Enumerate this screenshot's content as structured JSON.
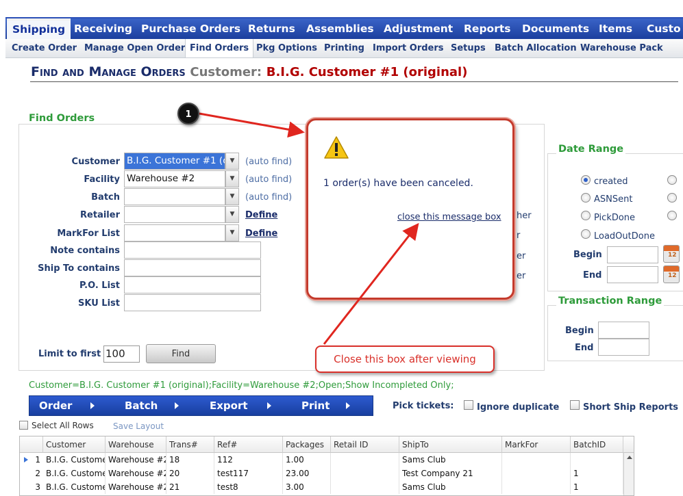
{
  "nav": {
    "top": [
      "Shipping",
      "Receiving",
      "Purchase Orders",
      "Returns",
      "Assemblies",
      "Adjustment",
      "Reports",
      "Documents",
      "Items",
      "Custo"
    ],
    "sub": [
      "Create Order",
      "Manage Open Order",
      "Find Orders",
      "Pkg Options",
      "Printing",
      "Import Orders",
      "Setups",
      "Batch Allocation",
      "Warehouse Pack"
    ]
  },
  "page": {
    "title": "Find and Manage Orders",
    "customer_label": "Customer:",
    "customer_value": "B.I.G. Customer #1 (original)"
  },
  "find_orders": {
    "legend": "Find Orders",
    "fields": {
      "customer": {
        "label": "Customer",
        "value": "B.I.G. Customer #1 (or",
        "hint": "(auto find)"
      },
      "facility": {
        "label": "Facility",
        "value": "Warehouse #2",
        "hint": "(auto find)"
      },
      "batch": {
        "label": "Batch",
        "value": "",
        "hint": "(auto find)"
      },
      "retailer": {
        "label": "Retailer",
        "value": "",
        "link": "Define"
      },
      "markfor": {
        "label": "MarkFor List",
        "value": "",
        "link": "Define"
      },
      "note": {
        "label": "Note contains",
        "value": ""
      },
      "shipto": {
        "label": "Ship To contains",
        "value": ""
      },
      "po": {
        "label": "P.O. List",
        "value": ""
      },
      "sku": {
        "label": "SKU List",
        "value": ""
      }
    },
    "partial_labels": [
      "her",
      "r",
      "er",
      "er"
    ],
    "limit_label": "Limit to first",
    "limit_value": "100",
    "find_button": "Find"
  },
  "date_range": {
    "legend": "Date Range",
    "options": [
      {
        "label": "created",
        "selected": true
      },
      {
        "label": "ASNSent",
        "selected": false
      },
      {
        "label": "PickDone",
        "selected": false
      },
      {
        "label": "LoadOutDone",
        "selected": false
      }
    ],
    "begin_label": "Begin",
    "end_label": "End"
  },
  "transaction_range": {
    "legend": "Transaction Range",
    "begin_label": "Begin",
    "end_label": "End"
  },
  "message_box": {
    "text": "1 order(s) have been canceled.",
    "close_link": "close this message box"
  },
  "annotation": {
    "step": "1",
    "callout": "Close this box after viewing",
    "color": "#d9302a"
  },
  "filter_summary": "Customer=B.I.G. Customer #1 (original);Facility=Warehouse #2;Open;Show Incompleted Only;",
  "actions": [
    "Order",
    "Batch",
    "Export",
    "Print"
  ],
  "pick_tickets": {
    "label": "Pick tickets:",
    "ignore_duplicate": "Ignore duplicate",
    "short_ship_reports": "Short Ship Reports"
  },
  "grid": {
    "select_all": "Select All Rows",
    "save_layout": "Save Layout",
    "columns": [
      "Customer",
      "Warehouse",
      "Trans#",
      "Ref#",
      "Packages",
      "Retail ID",
      "ShipTo",
      "MarkFor",
      "BatchID"
    ],
    "rows": [
      {
        "num": "1",
        "cells": [
          "B.I.G. Custome",
          "Warehouse #2",
          "18",
          "112",
          "1.00",
          "",
          "Sams Club",
          "",
          ""
        ]
      },
      {
        "num": "2",
        "cells": [
          "B.I.G. Custome",
          "Warehouse #2",
          "20",
          "test117",
          "23.00",
          "",
          "Test Company 21",
          "",
          "1"
        ]
      },
      {
        "num": "3",
        "cells": [
          "B.I.G. Custome",
          "Warehouse #2",
          "21",
          "test8",
          "3.00",
          "",
          "Sams Club",
          "",
          "1"
        ]
      }
    ]
  },
  "colors": {
    "nav_blue": "#1c3f9e",
    "legend_green": "#2e9b3a",
    "customer_red": "#b10000"
  }
}
